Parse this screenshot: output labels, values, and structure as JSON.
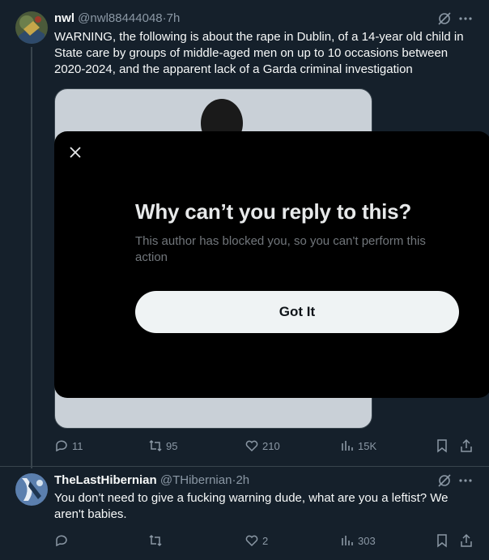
{
  "tweet1": {
    "name": "nwl",
    "handle": "@nwl88444048",
    "dot": "·",
    "time": "7h",
    "text": "WARNING, the following is about the rape in Dublin, of a 14-year old child in State care by groups of middle-aged men on up to 10 occasions between 2020-2024, and the apparent lack of a Garda criminal investigation",
    "replies": "11",
    "retweets": "95",
    "likes": "210",
    "views": "15K"
  },
  "tweet2": {
    "name": "TheLastHibernian",
    "handle": "@THibernian",
    "dot": "·",
    "time": "2h",
    "text": "You don't need to give a fucking warning dude, what are you a leftist? We aren't babies.",
    "replies": "",
    "retweets": "",
    "likes": "2",
    "views": "303"
  },
  "modal": {
    "title": "Why can’t you reply to this?",
    "body": "This author has blocked you, so you can't perform this action",
    "button": "Got It"
  },
  "icons": {
    "close": "close-icon",
    "grok": "grok-icon",
    "more": "more-icon",
    "reply": "reply-icon",
    "retweet": "retweet-icon",
    "like": "heart-icon",
    "views": "views-icon",
    "bookmark": "bookmark-icon",
    "share": "share-icon"
  },
  "colors": {
    "background": "#15202b",
    "modal": "#000000",
    "button": "#eff3f4",
    "muted": "#8b98a5"
  }
}
